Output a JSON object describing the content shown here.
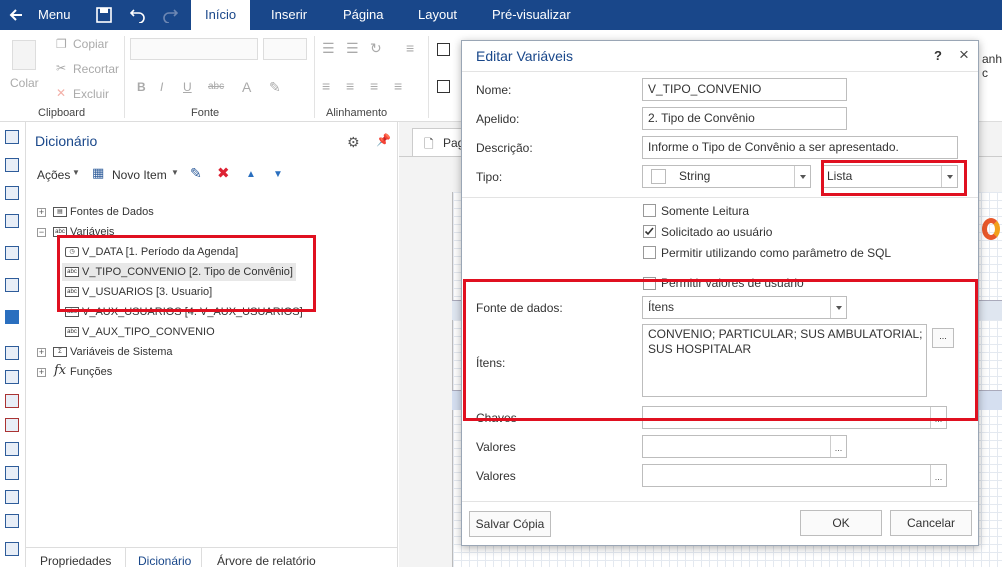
{
  "topbar": {
    "menu_label": "Menu",
    "tabs": [
      "Início",
      "Inserir",
      "Página",
      "Layout",
      "Pré-visualizar"
    ]
  },
  "ribbon": {
    "clipboard": {
      "paste": "Colar",
      "copy": "Copiar",
      "cut": "Recortar",
      "delete": "Excluir",
      "group": "Clipboard"
    },
    "font_group": "Fonte",
    "align_group": "Alinhamento",
    "right_cut_text": "anha c"
  },
  "dictionary": {
    "title": "Dicionário",
    "toolbar": {
      "actions": "Ações",
      "new_item": "Novo Item"
    },
    "tree": {
      "data_sources": "Fontes de Dados",
      "variables": "Variáveis",
      "var_items": [
        {
          "icon": "clock-icon",
          "label": "V_DATA [1. Período da Agenda]"
        },
        {
          "icon": "abc-icon",
          "label": "V_TIPO_CONVENIO [2. Tipo de Convênio]"
        },
        {
          "icon": "abc-icon",
          "label": "V_USUARIOS [3. Usuario]"
        },
        {
          "icon": "abc-icon",
          "label": "V_AUX_USUARIOS [4. V_AUX_USUARIOS]"
        },
        {
          "icon": "abc-icon",
          "label": "V_AUX_TIPO_CONVENIO"
        }
      ],
      "system_variables": "Variáveis de Sistema",
      "functions": "Funções"
    },
    "bottom_tabs": [
      "Propriedades",
      "Dicionário",
      "Árvore de relatório"
    ]
  },
  "canvas": {
    "page_tab": "Pag"
  },
  "dialog": {
    "title": "Editar Variáveis",
    "help": "?",
    "close": "×",
    "name_label": "Nome:",
    "name_value": "V_TIPO_CONVENIO",
    "alias_label": "Apelido:",
    "alias_value": "2. Tipo de Convênio",
    "desc_label": "Descrição:",
    "desc_value": "Informe o Tipo de Convênio a ser apresentado.",
    "type_label": "Tipo:",
    "type_value": "String",
    "type_kind": "Lista",
    "readonly_label": "Somente Leitura",
    "requested_label": "Solicitado ao usuário",
    "sqlparam_label": "Permitir utilizando como parâmetro de SQL",
    "uservalues_label": "Permitir valores de usuário",
    "source_label": "Fonte de dados:",
    "source_value": "Ítens",
    "items_label": "Ítens:",
    "items_value": "CONVENIO; PARTICULAR; SUS AMBULATORIAL; SUS HOSPITALAR",
    "keys_label": "Chaves",
    "values1_label": "Valores",
    "values2_label": "Valores",
    "save_copy": "Salvar Cópia",
    "ok": "OK",
    "cancel": "Cancelar"
  },
  "colors": {
    "brand": "#19478a",
    "highlight": "#e01020"
  }
}
